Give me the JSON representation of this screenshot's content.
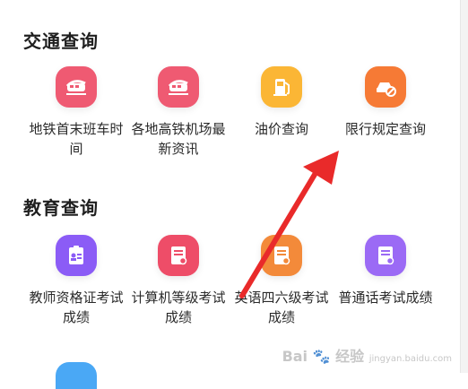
{
  "colors": {
    "metro": "#ef5a72",
    "fuel": "#fbb635",
    "restriction": "#f67a35",
    "teacher": "#8b5cf6",
    "computer": "#ee4d68",
    "cet": "#f38a3a",
    "mandarin": "#9b6af5",
    "arrow": "#e92a2a"
  },
  "traffic": {
    "title": "交通查询",
    "items": [
      {
        "label": "地铁首末班车时间",
        "icon": "train-icon"
      },
      {
        "label": "各地高铁机场最新资讯",
        "icon": "train-icon"
      },
      {
        "label": "油价查询",
        "icon": "fuel-pump-icon"
      },
      {
        "label": "限行规定查询",
        "icon": "no-car-icon"
      }
    ]
  },
  "education": {
    "title": "教育查询",
    "items": [
      {
        "label": "教师资格证考试成绩",
        "icon": "id-card-icon"
      },
      {
        "label": "计算机等级考试成绩",
        "icon": "document-icon"
      },
      {
        "label": "英语四六级考试成绩",
        "icon": "document-icon"
      },
      {
        "label": "普通话考试成绩",
        "icon": "document-icon"
      }
    ]
  },
  "watermark": {
    "brand": "Bai",
    "brand2": "经验",
    "sub": "jingyan.baidu.com"
  }
}
